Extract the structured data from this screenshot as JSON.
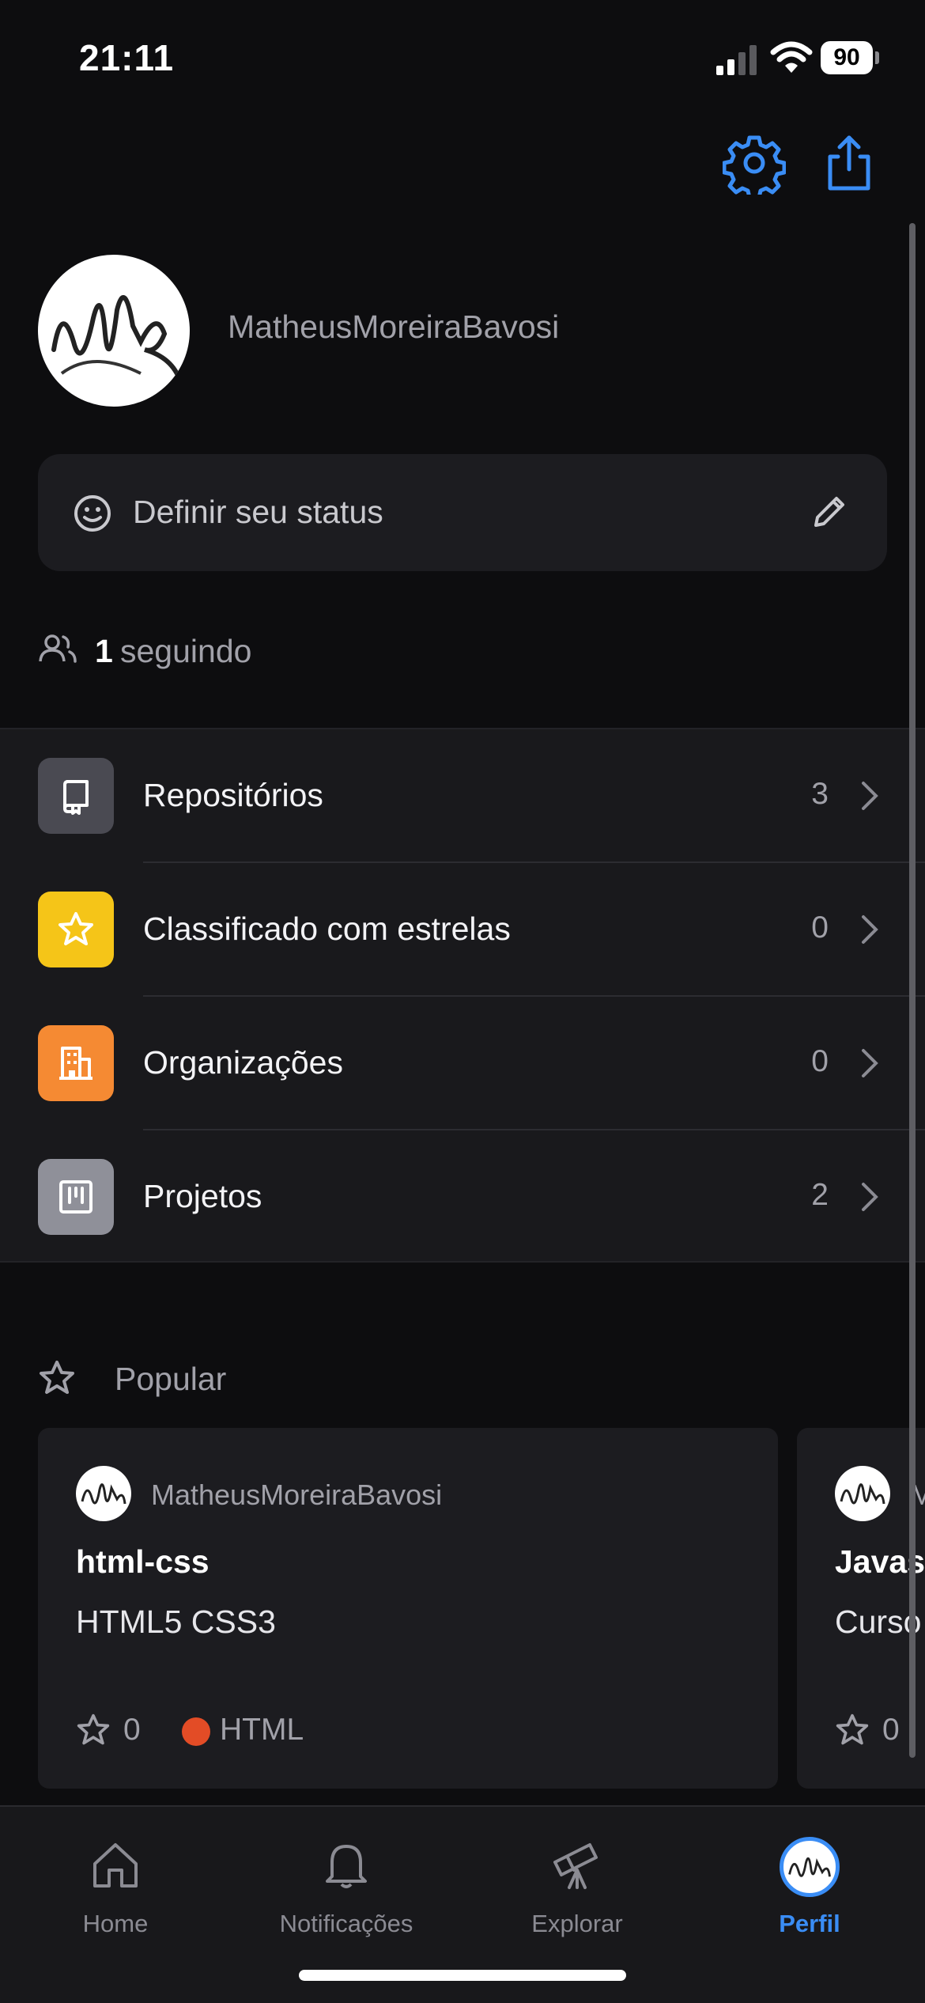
{
  "status_bar": {
    "time": "21:11",
    "battery": "90"
  },
  "profile": {
    "username": "MatheusMoreiraBavosi"
  },
  "status_box": {
    "placeholder": "Definir seu status"
  },
  "following": {
    "count": "1",
    "label": "seguindo"
  },
  "menu": [
    {
      "label": "Repositórios",
      "count": "3",
      "icon": "repo-icon",
      "tile_color": "#4a4a52"
    },
    {
      "label": "Classificado com estrelas",
      "count": "0",
      "icon": "star-icon",
      "tile_color": "#f5c518"
    },
    {
      "label": "Organizações",
      "count": "0",
      "icon": "organization-icon",
      "tile_color": "#f58a33"
    },
    {
      "label": "Projetos",
      "count": "2",
      "icon": "project-icon",
      "tile_color": "#8f9099"
    }
  ],
  "popular": {
    "heading": "Popular",
    "cards": [
      {
        "owner": "MatheusMoreiraBavosi",
        "title": "html-css",
        "description": "HTML5 CSS3",
        "stars": "0",
        "language": "HTML",
        "language_color": "#e34c26"
      },
      {
        "owner": "M",
        "title": "Javas",
        "description": "Curso",
        "stars": "0"
      }
    ]
  },
  "tabs": [
    {
      "label": "Home",
      "icon": "home-icon"
    },
    {
      "label": "Notificações",
      "icon": "bell-icon"
    },
    {
      "label": "Explorar",
      "icon": "telescope-icon"
    },
    {
      "label": "Perfil",
      "icon": "avatar",
      "active": true
    }
  ],
  "colors": {
    "accent": "#3a8df5",
    "background": "#0d0d0f",
    "surface": "#1c1c20"
  }
}
